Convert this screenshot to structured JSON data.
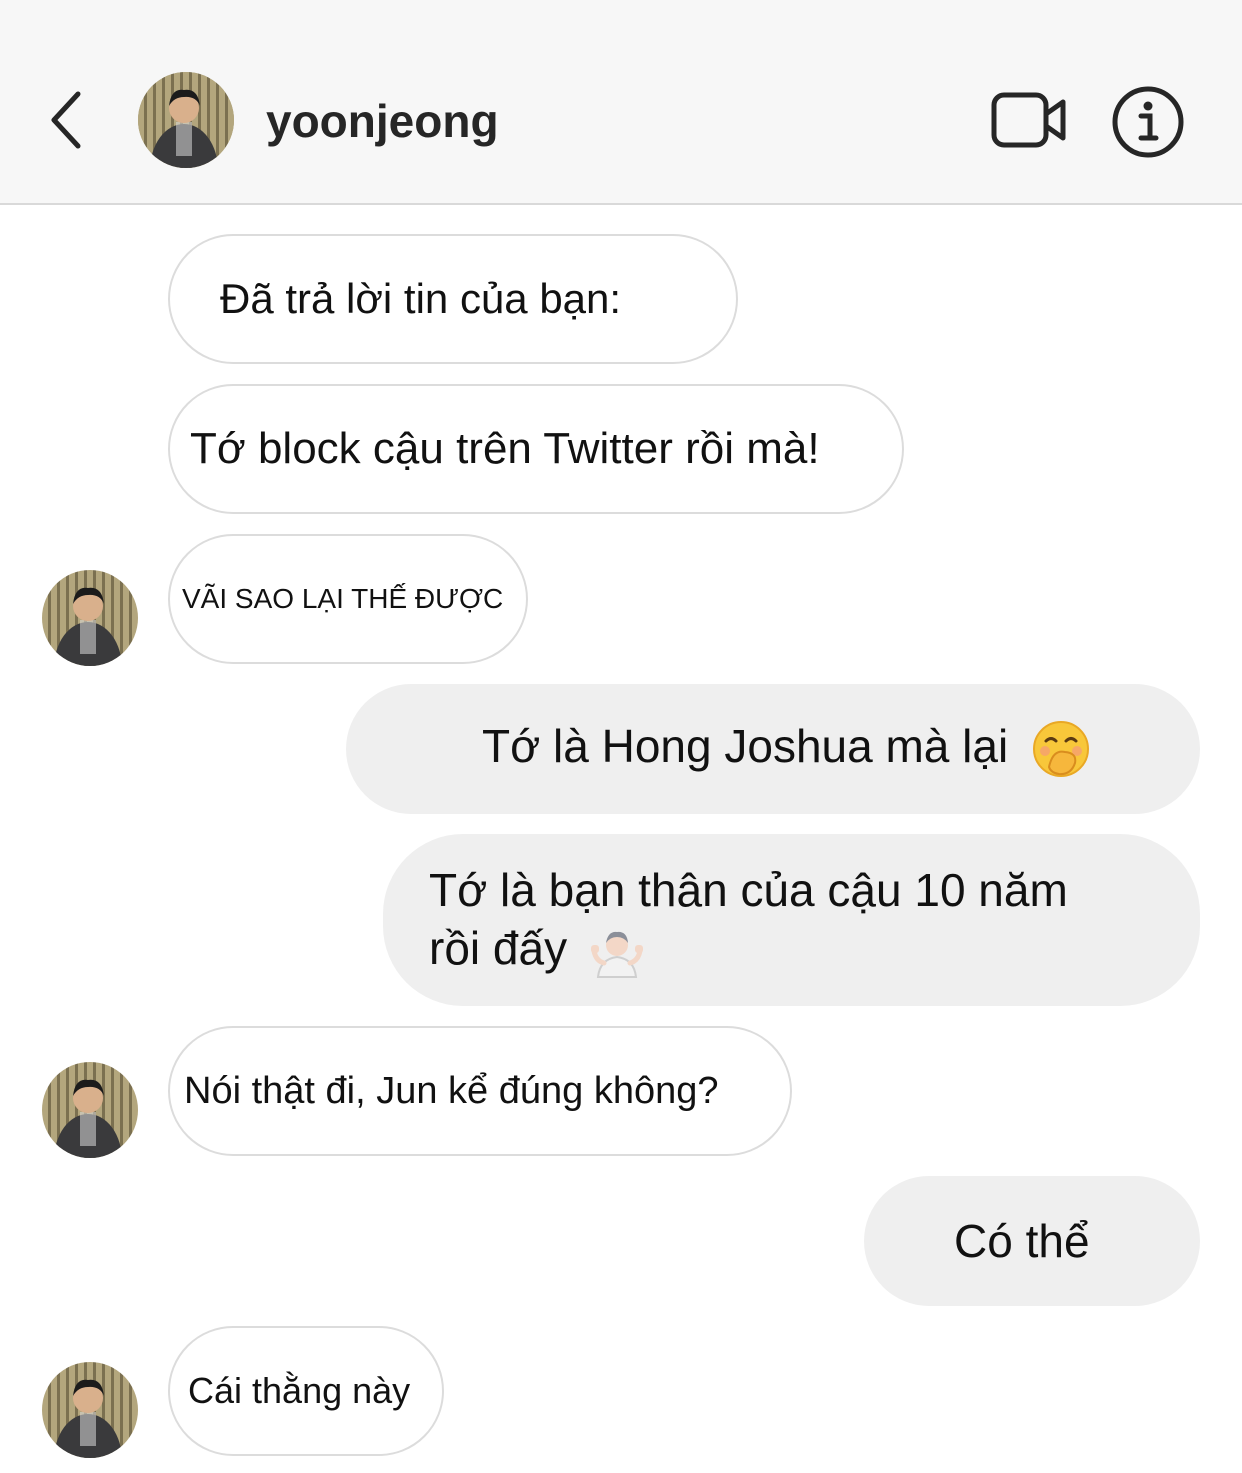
{
  "header": {
    "back_icon": "chevron-left-icon",
    "username": "yoonjeong",
    "video_icon": "video-camera-icon",
    "info_icon": "info-icon"
  },
  "messages": [
    {
      "direction": "incoming",
      "text": "Đã trả lời tin của bạn:"
    },
    {
      "direction": "incoming",
      "text": "Tớ block cậu trên Twitter rồi mà!"
    },
    {
      "direction": "incoming",
      "text": "VÃI SAO LẠI THẾ ĐƯỢC"
    },
    {
      "direction": "outgoing",
      "text": "Tớ là Hong Joshua mà lại",
      "emoji": "face-with-hand-over-mouth"
    },
    {
      "direction": "outgoing",
      "text_line1": "Tớ là bạn thân của cậu 10 năm",
      "text_line2": "rồi đấy",
      "emoji": "person-shrugging"
    },
    {
      "direction": "incoming",
      "text": "Nói thật đi, Jun kể đúng không?"
    },
    {
      "direction": "outgoing",
      "text": "Có thể"
    },
    {
      "direction": "incoming",
      "text": "Cái thằng này"
    }
  ],
  "colors": {
    "header_bg": "#f7f7f7",
    "incoming_bubble_bg": "#ffffff",
    "incoming_bubble_border": "#dcdcdc",
    "outgoing_bubble_bg": "#efefef",
    "text": "#111111"
  }
}
